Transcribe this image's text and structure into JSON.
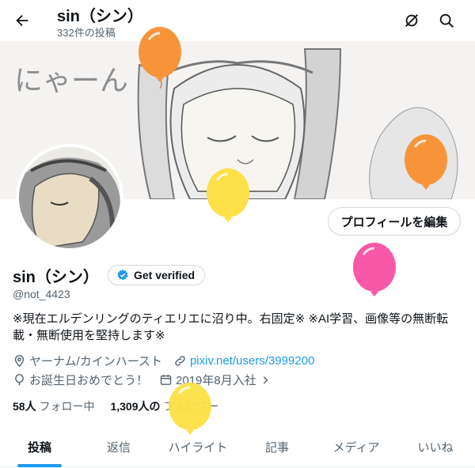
{
  "header": {
    "title": "sin（シン）",
    "post_count": "332件の投稿",
    "back_icon": "arrow-left-icon",
    "grok_icon": "grok-icon",
    "search_icon": "search-icon"
  },
  "banner": {
    "handwriting": "にゃーん"
  },
  "profile": {
    "display_name": "sin（シン）",
    "verified_label": "Get verified",
    "handle": "@not_4423",
    "edit_button": "プロフィールを編集",
    "bio_line1": "※現在エルデンリングのティエリエに沼り中。右固定※ ※AI学習、画像等の無断転",
    "bio_line2": "載・無断使用を堅持します※",
    "location": "ヤーナム/カインハースト",
    "website": "pixiv.net/users/3999200",
    "birthday": "お誕生日おめでとう！",
    "joined": "2019年8月入社",
    "following_count": "58人",
    "following_label": "フォロー中",
    "followers_count": "1,309人の",
    "followers_label": "フォロワー"
  },
  "tabs": [
    {
      "label": "投稿",
      "active": true
    },
    {
      "label": "返信",
      "active": false
    },
    {
      "label": "ハイライト",
      "active": false
    },
    {
      "label": "記事",
      "active": false
    },
    {
      "label": "メディア",
      "active": false
    },
    {
      "label": "いいね",
      "active": false
    }
  ],
  "colors": {
    "accent": "#1d9bf0",
    "balloon_orange": "#f7943a",
    "balloon_yellow": "#fde047",
    "balloon_pink": "#f758a8"
  }
}
